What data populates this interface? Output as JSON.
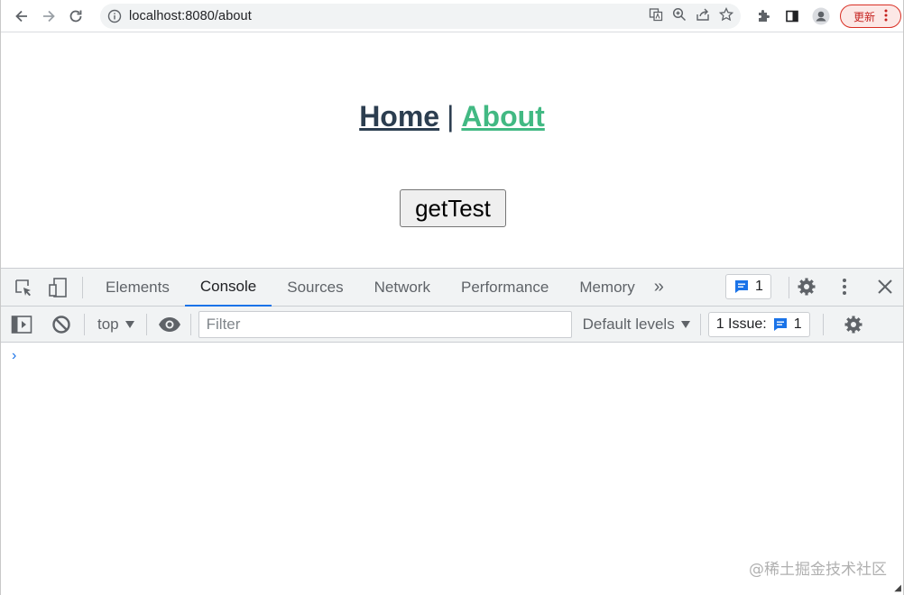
{
  "browser": {
    "url": "localhost:8080/about",
    "update_label": "更新",
    "icons": [
      "back-icon",
      "forward-icon",
      "reload-icon",
      "info-icon",
      "translate-icon",
      "zoom-icon",
      "share-icon",
      "star-icon",
      "extensions-icon",
      "sidepanel-icon",
      "profile-icon",
      "menu-icon"
    ]
  },
  "page": {
    "nav": {
      "home": "Home",
      "separator": "|",
      "about": "About"
    },
    "button_label": "getTest"
  },
  "devtools": {
    "tabs": [
      "Elements",
      "Console",
      "Sources",
      "Network",
      "Performance",
      "Memory"
    ],
    "active_tab": "Console",
    "more_label": "»",
    "issues_badge": "1",
    "context": "top",
    "filter_placeholder": "Filter",
    "levels_label": "Default levels",
    "issue_label": "1 Issue:",
    "issue_count": "1",
    "prompt": "›"
  },
  "watermark": "@稀土掘金技术社区",
  "colors": {
    "accent": "#1a73e8",
    "vue_green": "#42b983",
    "dark": "#2c3e50"
  }
}
